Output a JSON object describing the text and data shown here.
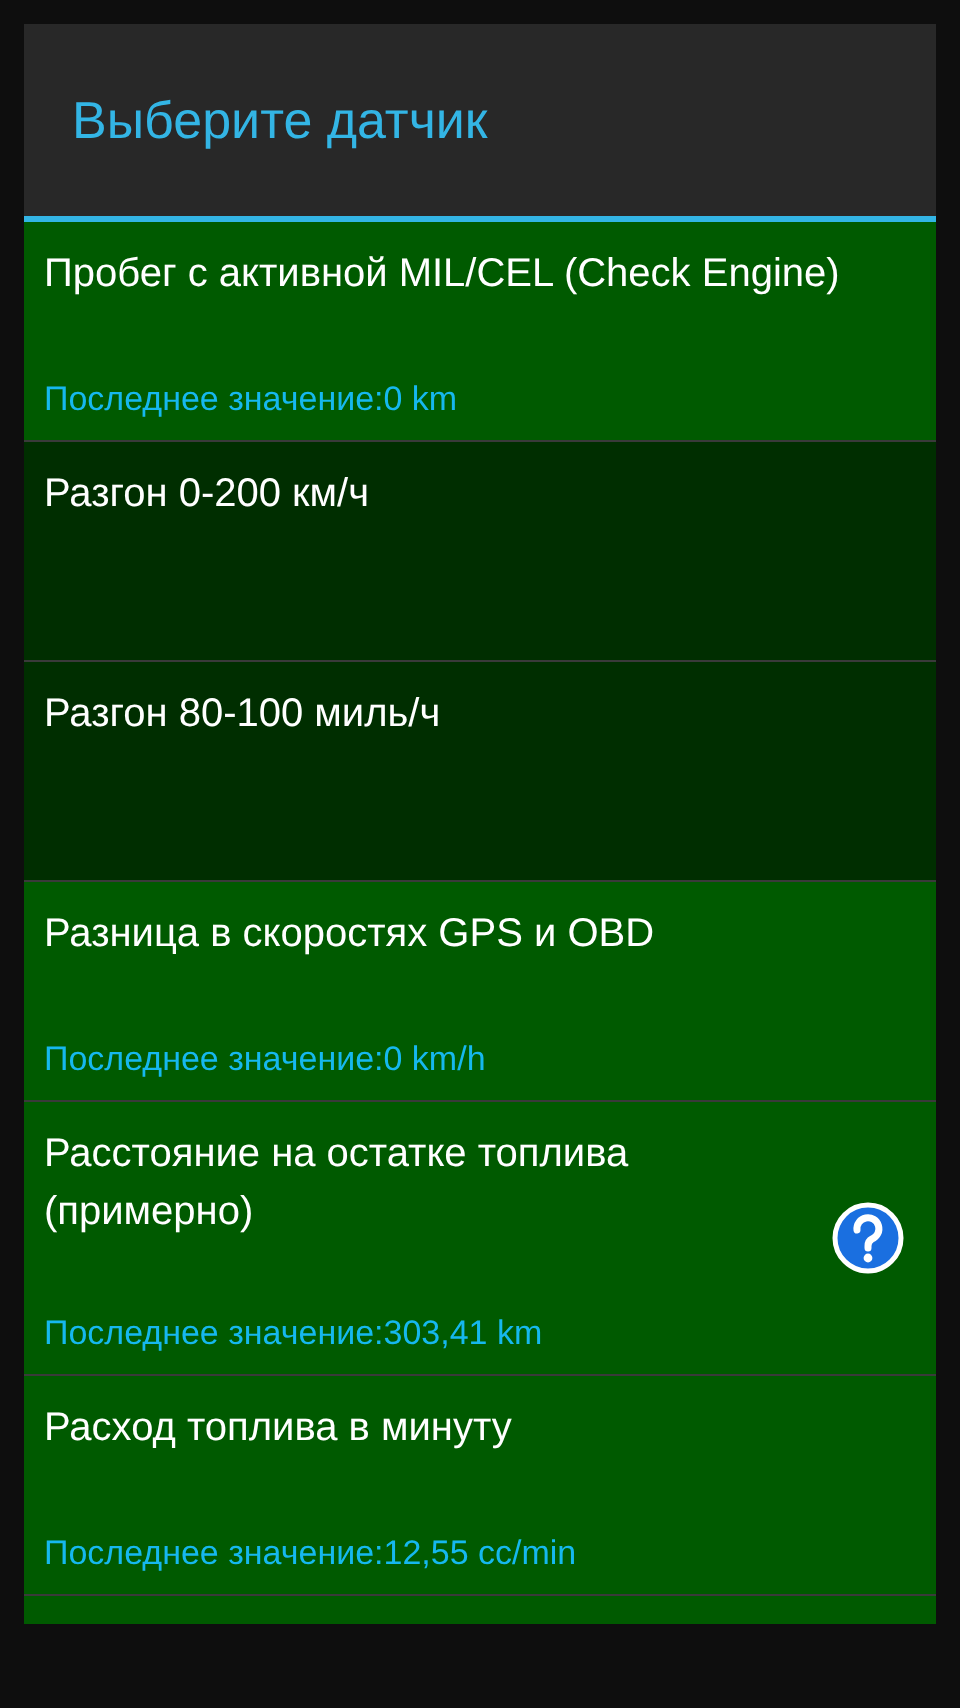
{
  "dialog": {
    "title": "Выберите датчик"
  },
  "sensors": [
    {
      "name": "Пробег с активной MIL/CEL (Check Engine)",
      "last_value": "Последнее значение:0 km",
      "has_data": true,
      "help": false
    },
    {
      "name": "Разгон 0-200 км/ч",
      "has_data": false,
      "help": false
    },
    {
      "name": "Разгон 80-100 миль/ч",
      "has_data": false,
      "help": false
    },
    {
      "name": "Разница в скоростях GPS и OBD",
      "last_value": "Последнее значение:0 km/h",
      "has_data": true,
      "help": false
    },
    {
      "name": "Расстояние на остатке топлива (примерно)",
      "last_value": "Последнее значение:303,41 km",
      "has_data": true,
      "help": true
    },
    {
      "name": "Расход топлива в минуту",
      "last_value": "Последнее значение:12,55 cc/min",
      "has_data": true,
      "help": false
    }
  ]
}
